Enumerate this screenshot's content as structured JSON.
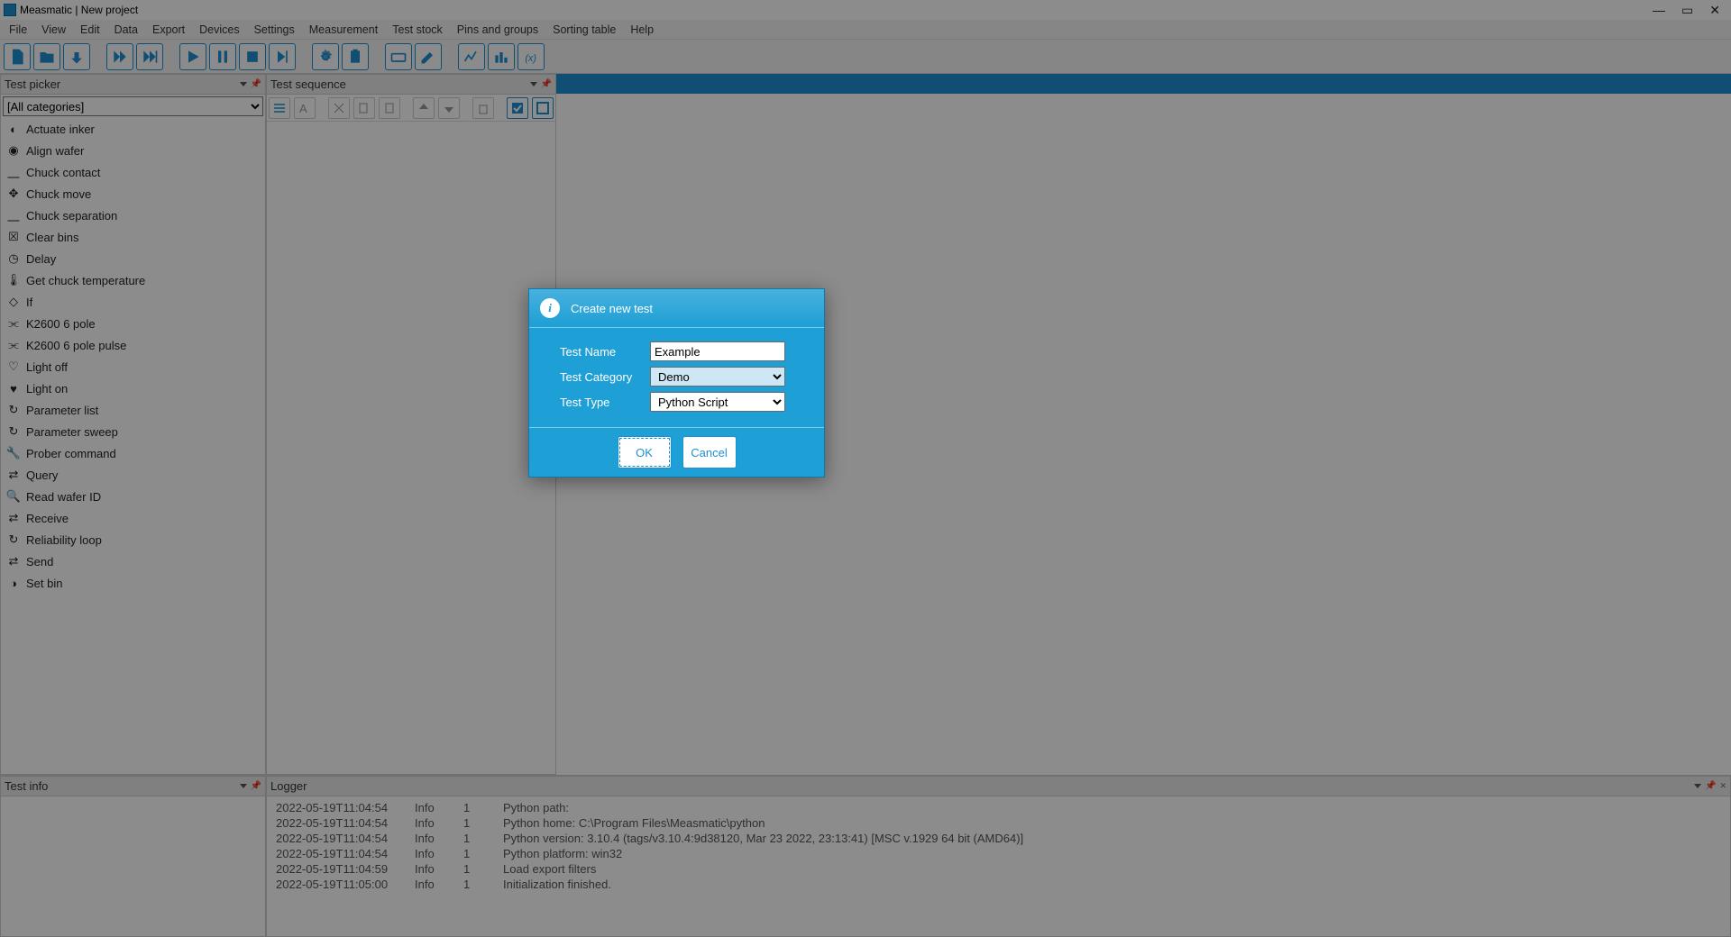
{
  "title": "Measmatic | New project",
  "menu": [
    "File",
    "View",
    "Edit",
    "Data",
    "Export",
    "Devices",
    "Settings",
    "Measurement",
    "Test stock",
    "Pins and groups",
    "Sorting table",
    "Help"
  ],
  "panels": {
    "picker": "Test picker",
    "sequence": "Test sequence",
    "info": "Test info",
    "logger": "Logger"
  },
  "category_select": "[All categories]",
  "tests": [
    "Actuate inker",
    "Align wafer",
    "Chuck contact",
    "Chuck move",
    "Chuck separation",
    "Clear bins",
    "Delay",
    "Get chuck temperature",
    "If",
    "K2600 6 pole",
    "K2600 6 pole pulse",
    "Light off",
    "Light on",
    "Parameter list",
    "Parameter sweep",
    "Prober command",
    "Query",
    "Read wafer ID",
    "Receive",
    "Reliability loop",
    "Send",
    "Set bin"
  ],
  "logger_rows": [
    {
      "ts": "2022-05-19T11:04:54",
      "lv": "Info",
      "n": "1",
      "msg": "Python path:"
    },
    {
      "ts": "2022-05-19T11:04:54",
      "lv": "Info",
      "n": "1",
      "msg": "Python home: C:\\Program Files\\Measmatic\\python"
    },
    {
      "ts": "2022-05-19T11:04:54",
      "lv": "Info",
      "n": "1",
      "msg": "Python version: 3.10.4 (tags/v3.10.4:9d38120, Mar 23 2022, 23:13:41) [MSC v.1929 64 bit (AMD64)]"
    },
    {
      "ts": "2022-05-19T11:04:54",
      "lv": "Info",
      "n": "1",
      "msg": "Python platform: win32"
    },
    {
      "ts": "2022-05-19T11:04:59",
      "lv": "Info",
      "n": "1",
      "msg": "Load export filters"
    },
    {
      "ts": "2022-05-19T11:05:00",
      "lv": "Info",
      "n": "1",
      "msg": "Initialization finished."
    }
  ],
  "dialog": {
    "title": "Create new test",
    "labels": {
      "name": "Test Name",
      "cat": "Test Category",
      "type": "Test Type"
    },
    "values": {
      "name": "Example",
      "cat": "Demo",
      "type": "Python Script"
    },
    "ok": "OK",
    "cancel": "Cancel"
  }
}
